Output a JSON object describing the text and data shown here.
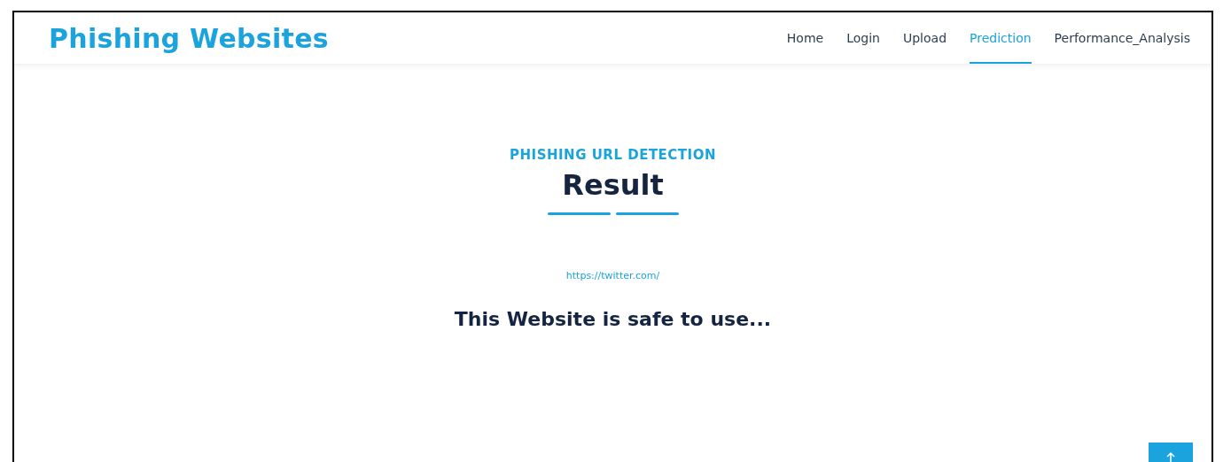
{
  "header": {
    "brand": "Phishing Websites",
    "nav": [
      {
        "label": "Home",
        "selected": false
      },
      {
        "label": "Login",
        "selected": false
      },
      {
        "label": "Upload",
        "selected": false
      },
      {
        "label": "Prediction",
        "selected": true
      },
      {
        "label": "Performance_Analysis",
        "selected": false
      }
    ]
  },
  "section": {
    "eyebrow": "PHISHING URL DETECTION",
    "title": "Result",
    "url": "https://twitter.com/",
    "message": "This Website is safe to use..."
  }
}
